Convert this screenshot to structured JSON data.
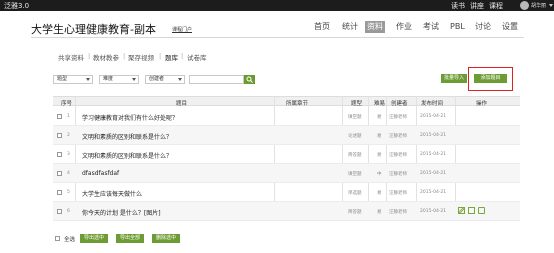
{
  "app": {
    "brand": "泛雅3.0"
  },
  "topnav": {
    "items": [
      "读书",
      "讲座",
      "课程"
    ],
    "user_name": "胡华丽"
  },
  "course": {
    "title": "大学生心理健康教育-副本",
    "portal_link": "课程门户"
  },
  "mainnav": {
    "items": [
      "首页",
      "统计",
      "资料",
      "作业",
      "考试",
      "PBL",
      "讨论",
      "设置"
    ],
    "active": "资料"
  },
  "subnav": {
    "items": [
      "共享资料",
      "教材教参",
      "聚存视频",
      "题库",
      "试卷库"
    ],
    "current": "题库"
  },
  "filters": {
    "type": "题型",
    "difficulty": "难度",
    "creator": "创建者",
    "search_placeholder": "",
    "batch_import": "批量导入",
    "add_question": "添加题目"
  },
  "table": {
    "headers": [
      "序号",
      "题目",
      "所属章节",
      "题型",
      "难易",
      "创建者",
      "发布时间",
      "操作"
    ],
    "rows": [
      {
        "index": "1",
        "title": "学习健康教育对我们有什么好处呢？",
        "chapter": "",
        "type": "填空题",
        "difficulty": "易",
        "creator": "汪静老师",
        "date": "2015-04-21"
      },
      {
        "index": "2",
        "title": "文明和素质的区别和联系是什么？",
        "chapter": "",
        "type": "论述题",
        "difficulty": "易",
        "creator": "汪静老师",
        "date": "2015-04-21"
      },
      {
        "index": "3",
        "title": "文明和素质的区别和联系是什么？",
        "chapter": "",
        "type": "简答题",
        "difficulty": "易",
        "creator": "汪静老师",
        "date": "2015-04-21"
      },
      {
        "index": "4",
        "title": "dfasdfasfdaf",
        "chapter": "",
        "type": "填空题",
        "difficulty": "中",
        "creator": "汪静老师",
        "date": "2015-04-21"
      },
      {
        "index": "5",
        "title": "大学生应该每天做什么",
        "chapter": "",
        "type": "单选题",
        "difficulty": "易",
        "creator": "汪静老师",
        "date": "2015-04-21"
      },
      {
        "index": "6",
        "title": "你今天的计划 是什么？[图片]",
        "chapter": "",
        "type": "简答题",
        "difficulty": "易",
        "creator": "汪静老师",
        "date": "2015-04-21"
      }
    ]
  },
  "footer": {
    "select_all": "全选",
    "export_selected": "导出选中",
    "export_all": "导出全部",
    "delete_selected": "删除选中"
  },
  "colors": {
    "accent": "#6e9c34",
    "topbar": "#1c1c1c",
    "highlight": "#dd2222"
  }
}
